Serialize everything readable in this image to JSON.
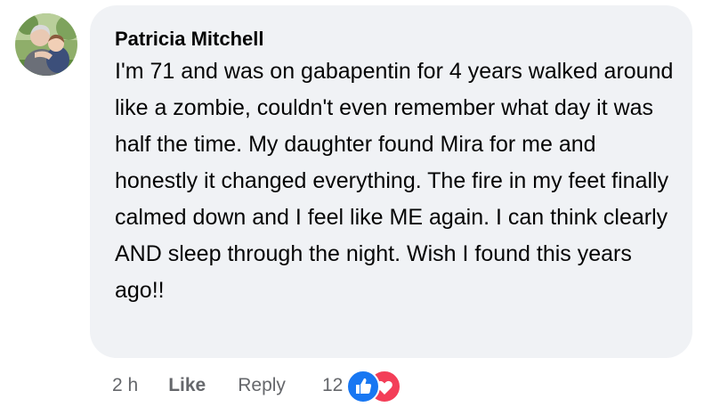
{
  "comment": {
    "author": "Patricia Mitchell",
    "text": "I'm 71 and was on gabapentin for 4 years walked around like a zombie, couldn't even remember what day it was half the time. My daughter found Mira for me and honestly it changed everything. The fire in my feet finally calmed down and I feel like ME again. I can think clearly AND sleep through the night. Wish I found this years ago!!",
    "avatar_icon": "user-photo-avatar"
  },
  "actions": {
    "timestamp": "2 h",
    "like_label": "Like",
    "reply_label": "Reply",
    "reaction_count": "12",
    "reaction_icons": [
      "like-reaction-icon",
      "love-reaction-icon"
    ]
  },
  "colors": {
    "bubble_bg": "#f0f2f5",
    "secondary_text": "#65676b",
    "like_blue": "#1877f2",
    "love_red": "#f33e58"
  }
}
